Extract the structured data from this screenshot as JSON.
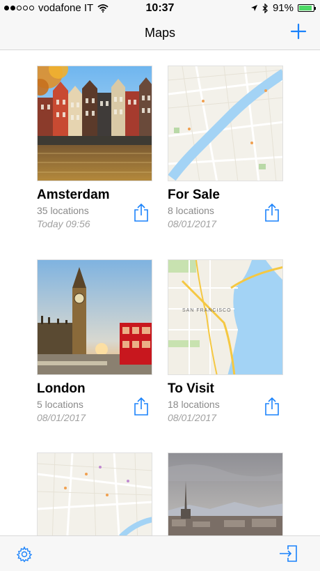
{
  "status": {
    "carrier": "vodafone IT",
    "time": "10:37",
    "battery": "91%",
    "battery_level": 0.91,
    "signal_bars_filled": 2,
    "signal_bars_total": 5
  },
  "nav": {
    "title": "Maps",
    "add_icon": "plus-icon"
  },
  "maps": [
    {
      "title": "Amsterdam",
      "count": "35 locations",
      "date": "Today 09:56",
      "thumbnail": "amsterdam-photo"
    },
    {
      "title": "For Sale",
      "count": "8 locations",
      "date": "08/01/2017",
      "thumbnail": "map-river"
    },
    {
      "title": "London",
      "count": "5 locations",
      "date": "08/01/2017",
      "thumbnail": "london-photo"
    },
    {
      "title": "To Visit",
      "count": "18 locations",
      "date": "08/01/2017",
      "thumbnail": "map-san-francisco"
    },
    {
      "title": "",
      "count": "",
      "date": "",
      "thumbnail": "map-city"
    },
    {
      "title": "",
      "count": "",
      "date": "",
      "thumbnail": "turin-photo"
    }
  ],
  "map_labels": {
    "san_francisco": "SAN FRANCISCO"
  },
  "toolbar": {
    "settings_icon": "gear-icon",
    "export_icon": "export-icon"
  },
  "colors": {
    "accent": "#1a82fb",
    "battery": "#4cd964",
    "water": "#a3d3f5"
  }
}
